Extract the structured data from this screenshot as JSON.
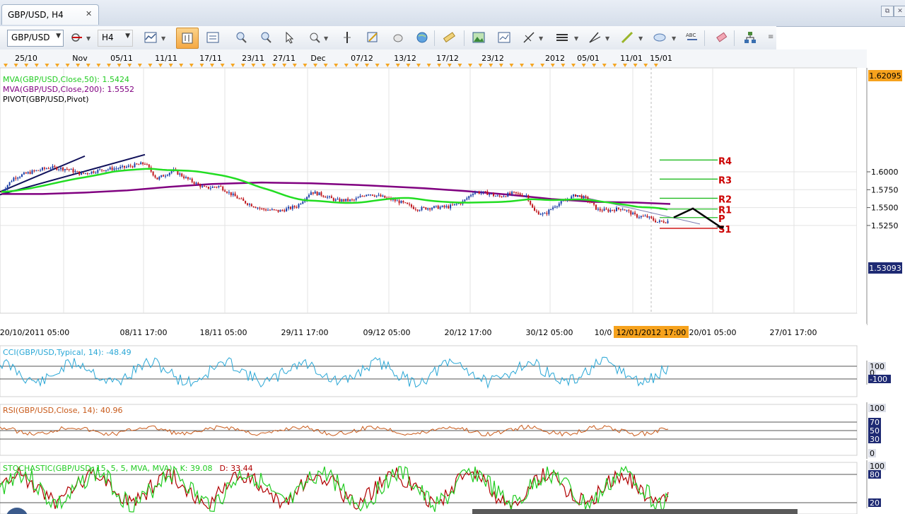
{
  "tab": {
    "title": "GBP/USD, H4",
    "close": "✕"
  },
  "toolbar": {
    "symbol": "GBP/USD",
    "timeframe": "H4"
  },
  "window_buttons": {
    "restore": "⧉",
    "close": "✕"
  },
  "date_axis_top": [
    "25/10",
    "Nov",
    "05/11",
    "11/11",
    "17/11",
    "23/11",
    "27/11",
    "Dec",
    "07/12",
    "13/12",
    "17/12",
    "23/12",
    "2012",
    "05/01",
    "11/01",
    "15/01"
  ],
  "date_axis_bottom": [
    "20/10/2011 05:00",
    "08/11 17:00",
    "18/11 05:00",
    "29/11 17:00",
    "09/12 05:00",
    "20/12 17:00",
    "30/12 05:00",
    "10/0",
    "20/01 05:00",
    "27/01 17:00"
  ],
  "crosshair_time": "12/01/2012 17:00",
  "price_axis": {
    "ticks": [
      "1.6000",
      "1.5750",
      "1.5500",
      "1.5250"
    ],
    "top_label": "1.62095",
    "current_label": "1.53093"
  },
  "legend": {
    "mva50": "MVA(GBP/USD,Close,50): 1.5424",
    "mva200": "MVA(GBP/USD,Close,200): 1.5552",
    "pivot": "PIVOT(GBP/USD,Pivot)"
  },
  "pivot_levels": [
    {
      "label": "R4",
      "value": 1.6165
    },
    {
      "label": "R3",
      "value": 1.5898
    },
    {
      "label": "R2",
      "value": 1.563
    },
    {
      "label": "R1",
      "value": 1.548
    },
    {
      "label": "P",
      "value": 1.536
    },
    {
      "label": "S1",
      "value": 1.521
    }
  ],
  "cci": {
    "legend": "CCI(GBP/USD,Typical, 14): -48.49",
    "ticks": [
      "100",
      "0",
      "-100"
    ]
  },
  "rsi": {
    "legend": "RSI(GBP/USD,Close, 14): 40.96",
    "ticks": [
      "100",
      "70",
      "50",
      "30",
      "0"
    ]
  },
  "stoch": {
    "legend_main": "STOCHASTIC(GBP/USD, 15, 5, 5, MVA, MVA) - ",
    "k": "K: 39.08",
    "d": "D: 33.44",
    "ticks": [
      "100",
      "80",
      "20"
    ]
  },
  "colors": {
    "mva50": "#22dd22",
    "mva200": "#800080",
    "up_candle": "#1a3fa8",
    "down_candle": "#c0171d",
    "pivot": "#cc0000",
    "cci": "#2aa7d6",
    "rsi": "#c85a1a",
    "stoch_k": "#22cc22",
    "stoch_d": "#b00000"
  }
}
